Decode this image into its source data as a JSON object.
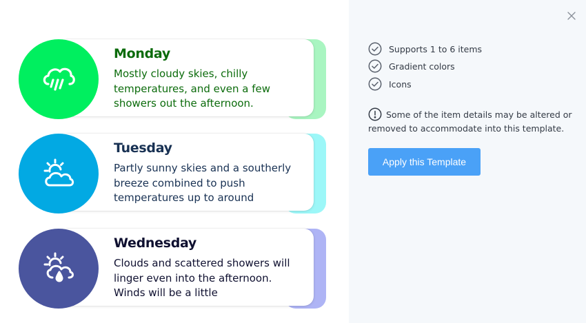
{
  "cards": [
    {
      "title": "Monday",
      "description": "Mostly cloudy skies, chilly temperatures, and even a few showers out the afternoon.",
      "icon": "cloud-rain-icon",
      "circle_color": "#00ef5f",
      "tab_color": "#a9f5c1",
      "text_color": "#0b6b0b"
    },
    {
      "title": "Tuesday",
      "description": "Partly sunny skies and a southerly breeze combined to push temperatures up to around",
      "icon": "partly-sunny-icon",
      "circle_color": "#02a9e3",
      "tab_color": "#9cf7f8",
      "text_color": "#183153"
    },
    {
      "title": "Wednesday",
      "description": "Clouds and scattered showers will linger even into the afternoon. Winds will be a little",
      "icon": "sun-cloud-rain-icon",
      "circle_color": "#4a559e",
      "tab_color": "#aeb4f5",
      "text_color": "#0f1030"
    }
  ],
  "panel": {
    "features": [
      "Supports 1 to 6 items",
      "Gradient colors",
      "Icons"
    ],
    "note": "Some of the item details may be altered or removed to accommodate into this template.",
    "apply_label": "Apply this Template",
    "close_icon": "close-icon",
    "check_icon": "check-circle-icon",
    "info_icon": "exclamation-circle-icon",
    "accent_color": "#4aa1f7"
  }
}
